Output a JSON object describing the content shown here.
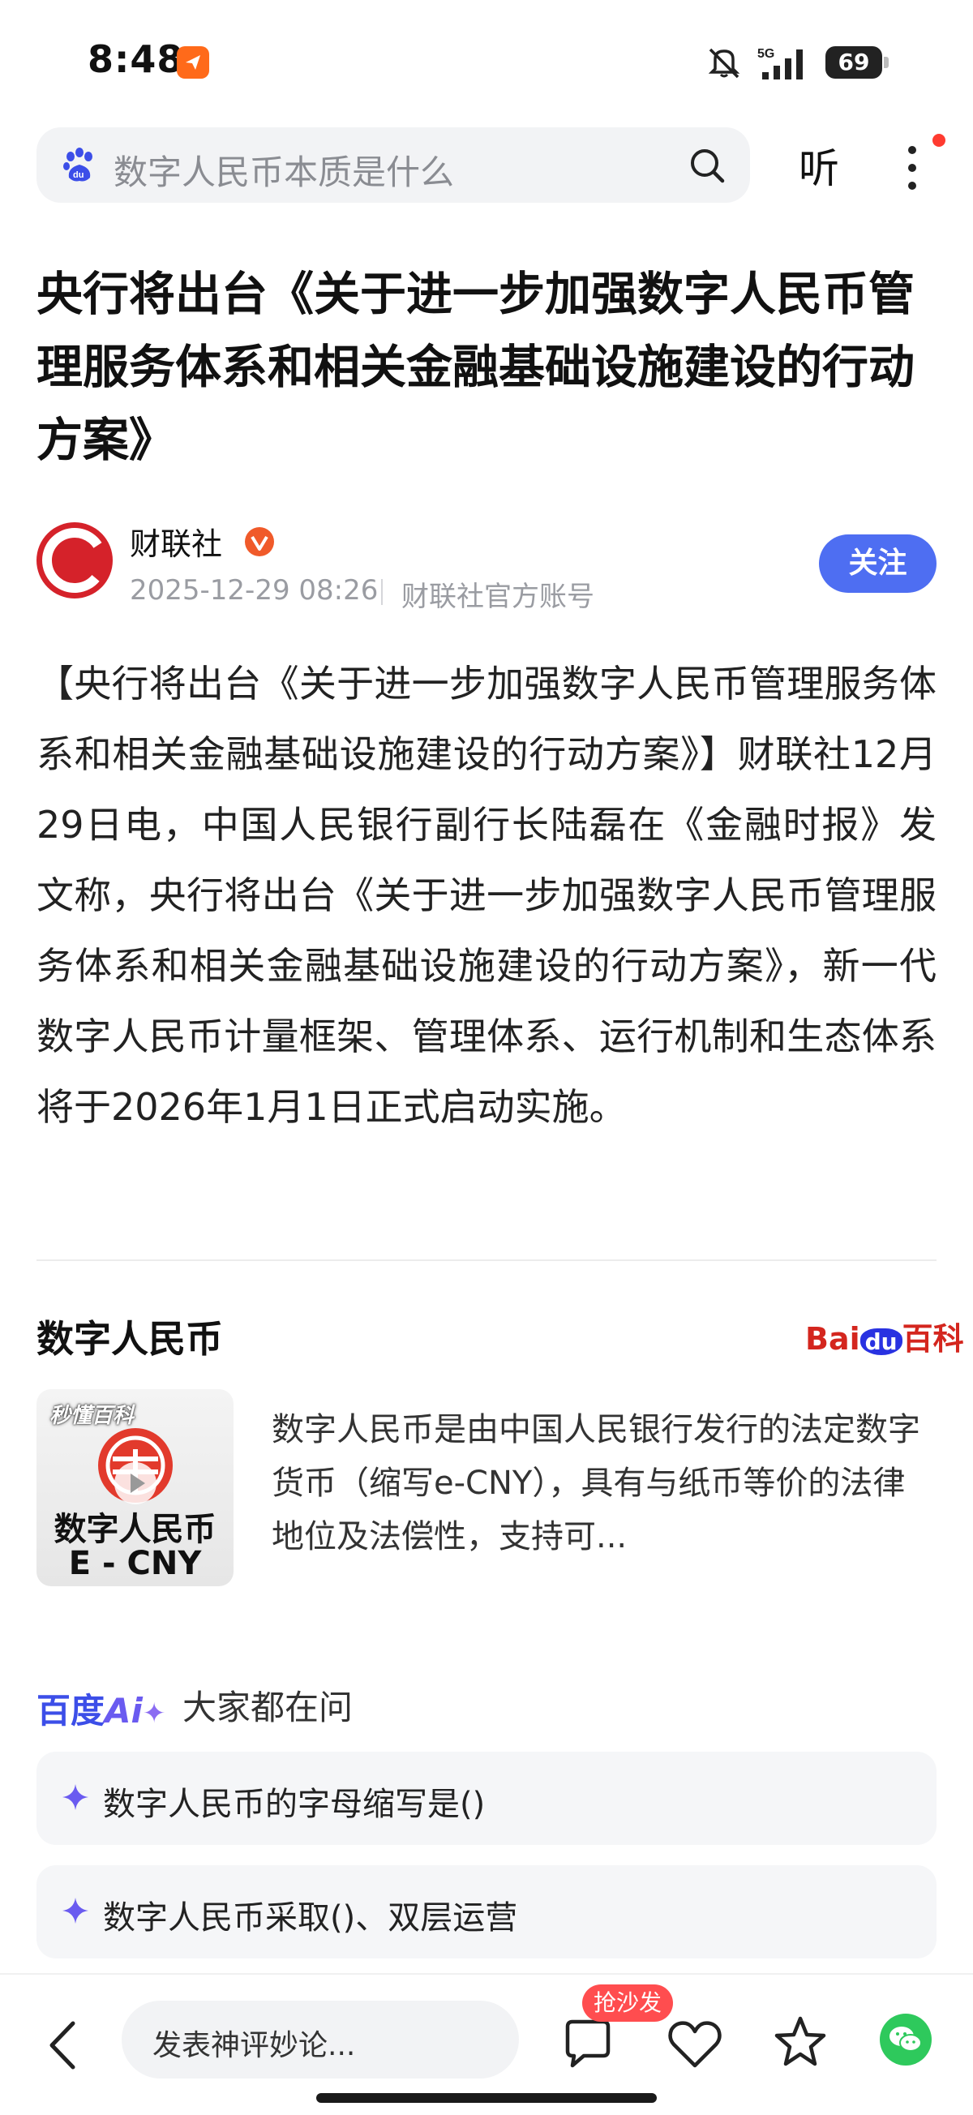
{
  "status_bar": {
    "time": "8:48",
    "battery": "69",
    "network": "5G"
  },
  "search": {
    "placeholder": "数字人民币本质是什么"
  },
  "header": {
    "listen_label": "听"
  },
  "article": {
    "title": "央行将出台《关于进一步加强数字人民币管理服务体系和相关金融基础设施建设的行动方案》",
    "author": "财联社",
    "avatar_letter": "C",
    "time": "2025-12-29 08:26",
    "account_type": "财联社官方账号",
    "follow_label": "关注",
    "body": "【央行将出台《关于进一步加强数字人民币管理服务体系和相关金融基础设施建设的行动方案》】财联社12月29日电，中国人民银行副行长陆磊在《金融时报》发文称，央行将出台《关于进一步加强数字人民币管理服务体系和相关金融基础设施建设的行动方案》，新一代数字人民币计量框架、管理体系、运行机制和生态体系将于2026年1月1日正式启动实施。"
  },
  "baike": {
    "title": "数字人民币",
    "logo_bai": "Bai",
    "logo_du": "du",
    "logo_baike": "百科",
    "thumb_badge": "秒懂百科",
    "thumb_line1": "数字人民币",
    "thumb_line2": "E - CNY",
    "description": "数字人民币是由中国人民银行发行的法定数字货币（缩写e-CNY），具有与纸币等价的法律地位及法偿性，支持可..."
  },
  "ai_section": {
    "logo_baidu": "百度",
    "logo_ai": "Ai",
    "subtitle": "大家都在问",
    "questions": [
      {
        "text": "数字人民币的字母缩写是()"
      },
      {
        "text": "数字人民币采取()、双层运营"
      }
    ]
  },
  "bottom_bar": {
    "comment_placeholder": "发表神评妙论...",
    "sofa_badge": "抢沙发"
  },
  "colors": {
    "accent": "#4e6ef2",
    "avatar": "#d5222a",
    "baike_red": "#d4261e",
    "ai_purple": "#6a5bf0",
    "wechat_green": "#2ec95c",
    "badge_red": "#ff4d4f"
  },
  "icons": [
    "app-notification-icon",
    "mute-icon",
    "signal-icon",
    "battery-icon",
    "baidu-paw-icon",
    "search-icon",
    "more-icon",
    "verified-icon",
    "play-icon",
    "sparkle-icon",
    "back-icon",
    "comment-icon",
    "like-icon",
    "favorite-star-icon",
    "wechat-icon"
  ]
}
